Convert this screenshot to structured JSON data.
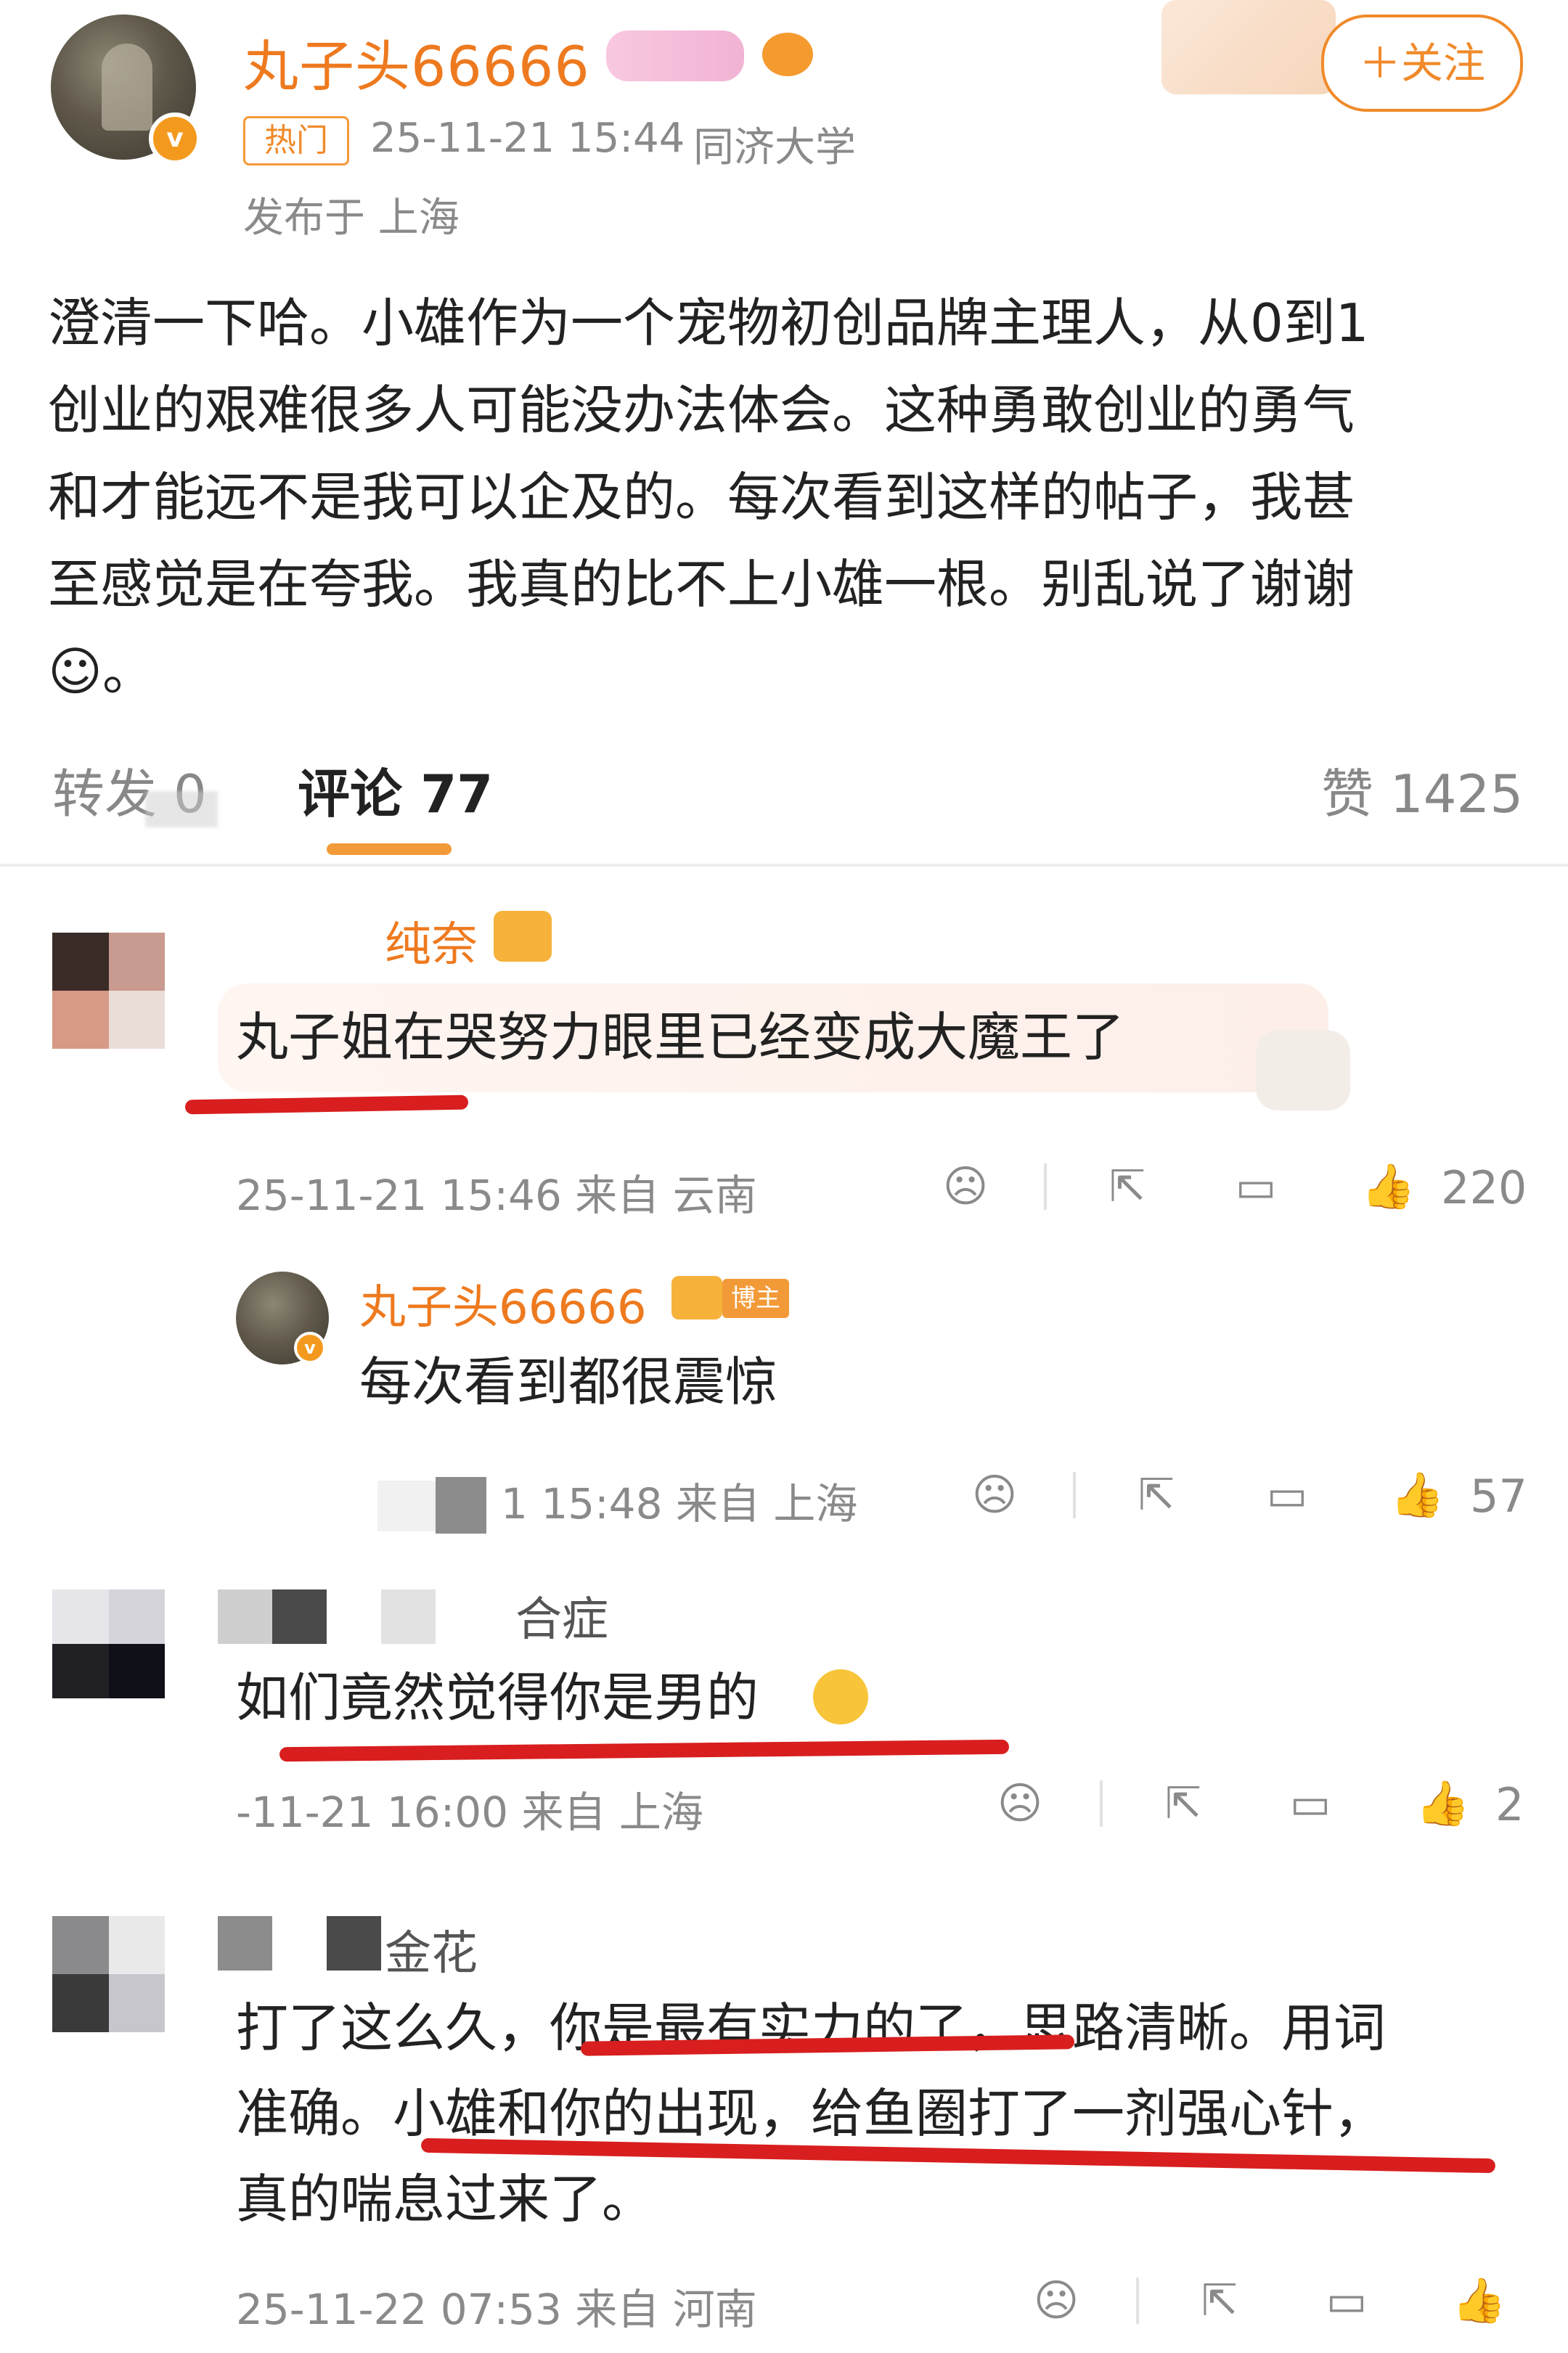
{
  "post": {
    "author": "丸子头66666",
    "hot_tag": "热门",
    "timestamp": "25-11-21 15:44",
    "school": "同济大学",
    "location": "发布于 上海",
    "follow_label": "＋关注",
    "content_lines": [
      "澄清一下哈。小雄作为一个宠物初创品牌主理人，从0到1",
      "创业的艰难很多人可能没办法体会。这种勇敢创业的勇气",
      "和才能远不是我可以企及的。每次看到这样的帖子，我甚",
      "至感觉是在夸我。我真的比不上小雄一根。别乱说了谢谢",
      "☺。"
    ]
  },
  "stats": {
    "repost": "转发 0",
    "comment": "评论 77",
    "like": "赞 1425"
  },
  "comments": [
    {
      "name": "纯奈",
      "text": "丸子姐在哭努力眼里已经变成大魔王了",
      "meta": "25-11-21 15:46 来自 云南",
      "likes": "220"
    },
    {
      "name": "丸子头66666",
      "badge": "博主",
      "text": "每次看到都很震惊",
      "meta": "1 15:48 来自 上海",
      "likes": "57"
    },
    {
      "name": "合症",
      "text": "如们竟然觉得你是男的",
      "meta": "-11-21 16:00 来自 上海",
      "likes": "2"
    },
    {
      "name": "金花",
      "lines": [
        "打了这么久，你是最有实力的了，思路清晰。用词",
        "准确。小雄和你的出现，给鱼圈打了一剂强心针，",
        "真的喘息过来了。"
      ],
      "meta": "25-11-22 07:53 来自 河南"
    }
  ],
  "icons": {
    "dislike": "frown-icon",
    "share": "share-icon",
    "reply": "comment-icon",
    "like": "thumb-up-icon"
  },
  "colors": {
    "accent": "#ee7a1f",
    "annotation": "#d81e1e"
  }
}
